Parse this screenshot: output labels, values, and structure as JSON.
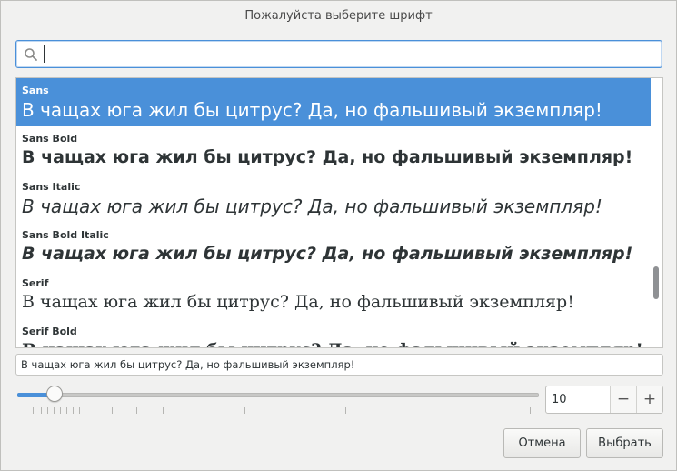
{
  "dialog": {
    "title": "Пожалуйста выберите шрифт"
  },
  "search": {
    "value": "",
    "icon": "search-icon"
  },
  "fonts": [
    {
      "name": "Sans",
      "sample": "В чащах юга жил бы цитрус? Да, но фальшивый экземпляр!",
      "selected": true
    },
    {
      "name": "Sans Bold",
      "sample": "В чащах юга жил бы цитрус? Да, но фальшивый экземпляр!"
    },
    {
      "name": "Sans Italic",
      "sample": "В чащах юга жил бы цитрус? Да, но фальшивый экземпляр!"
    },
    {
      "name": "Sans Bold Italic",
      "sample": "В чащах юга жил бы цитрус? Да, но фальшивый экземпляр!"
    },
    {
      "name": "Serif",
      "sample": "В чащах юга жил бы цитрус? Да, но фальшивый экземпляр!"
    },
    {
      "name": "Serif Bold",
      "sample": "В чащах юга жил бы цитрус? Да, но фальшивый экземпляр!"
    }
  ],
  "preview": {
    "text": "В чащах юга жил бы цитрус? Да, но фальшивый экземпляр!"
  },
  "size": {
    "value": "10",
    "minus": "−",
    "plus": "+",
    "slider_fraction": 0.07
  },
  "buttons": {
    "cancel": "Отмена",
    "select": "Выбрать"
  },
  "colors": {
    "accent": "#4a90d9",
    "text": "#2e3436"
  }
}
